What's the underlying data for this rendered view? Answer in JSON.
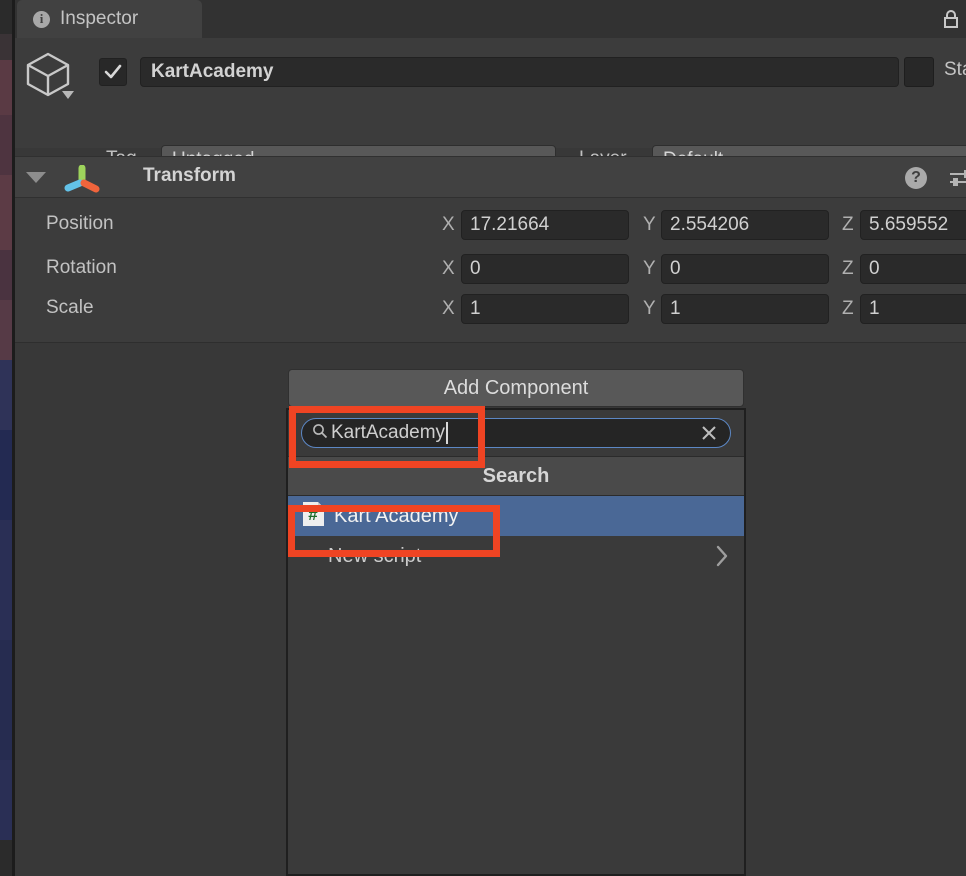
{
  "window": {
    "tab_label": "Inspector",
    "tab_icon": "info-icon",
    "lock_icon": "lock-icon"
  },
  "object_header": {
    "object_icon": "cube-icon",
    "enabled_checked": true,
    "name": "KartAcademy",
    "static_label": "Sta",
    "static_checked": false,
    "tag_label": "Tag",
    "tag_value": "Untagged",
    "layer_label": "Layer",
    "layer_value": "Default"
  },
  "transform": {
    "title": "Transform",
    "icon": "transform-gizmo-icon",
    "help_icon": "?",
    "preset_icon": "preset-settings-icon",
    "rows": [
      {
        "label": "Position",
        "x_axis": "X",
        "x": "17.21664",
        "y_axis": "Y",
        "y": "2.554206",
        "z_axis": "Z",
        "z": "5.659552"
      },
      {
        "label": "Rotation",
        "x_axis": "X",
        "x": "0",
        "y_axis": "Y",
        "y": "0",
        "z_axis": "Z",
        "z": "0"
      },
      {
        "label": "Scale",
        "x_axis": "X",
        "x": "1",
        "y_axis": "Y",
        "y": "1",
        "z_axis": "Z",
        "z": "1"
      }
    ]
  },
  "add_component": {
    "button_label": "Add Component",
    "search": {
      "value": "KartAcademy",
      "placeholder": "Search",
      "magnifier_icon": "search-icon",
      "clear_icon": "close-icon"
    },
    "section_header": "Search",
    "results": [
      {
        "label": "Kart Academy",
        "icon": "csharp-script-icon",
        "selected": true
      }
    ],
    "new_script_label": "New script",
    "new_script_chevron": "chevron-right-icon"
  },
  "annotations": {
    "accent_color": "#ef4423",
    "boxes": [
      "search-field-highlight",
      "kart-academy-result-highlight"
    ]
  },
  "colors": {
    "panel_bg": "#383838",
    "header_bg": "#3c3c3c",
    "component_header_bg": "#414141",
    "selection_blue": "#4a6896",
    "field_bg": "#2a2a2a",
    "dropdown_bg": "#585858",
    "focus_border": "#5c87c4",
    "annotation_red": "#ef4423"
  }
}
